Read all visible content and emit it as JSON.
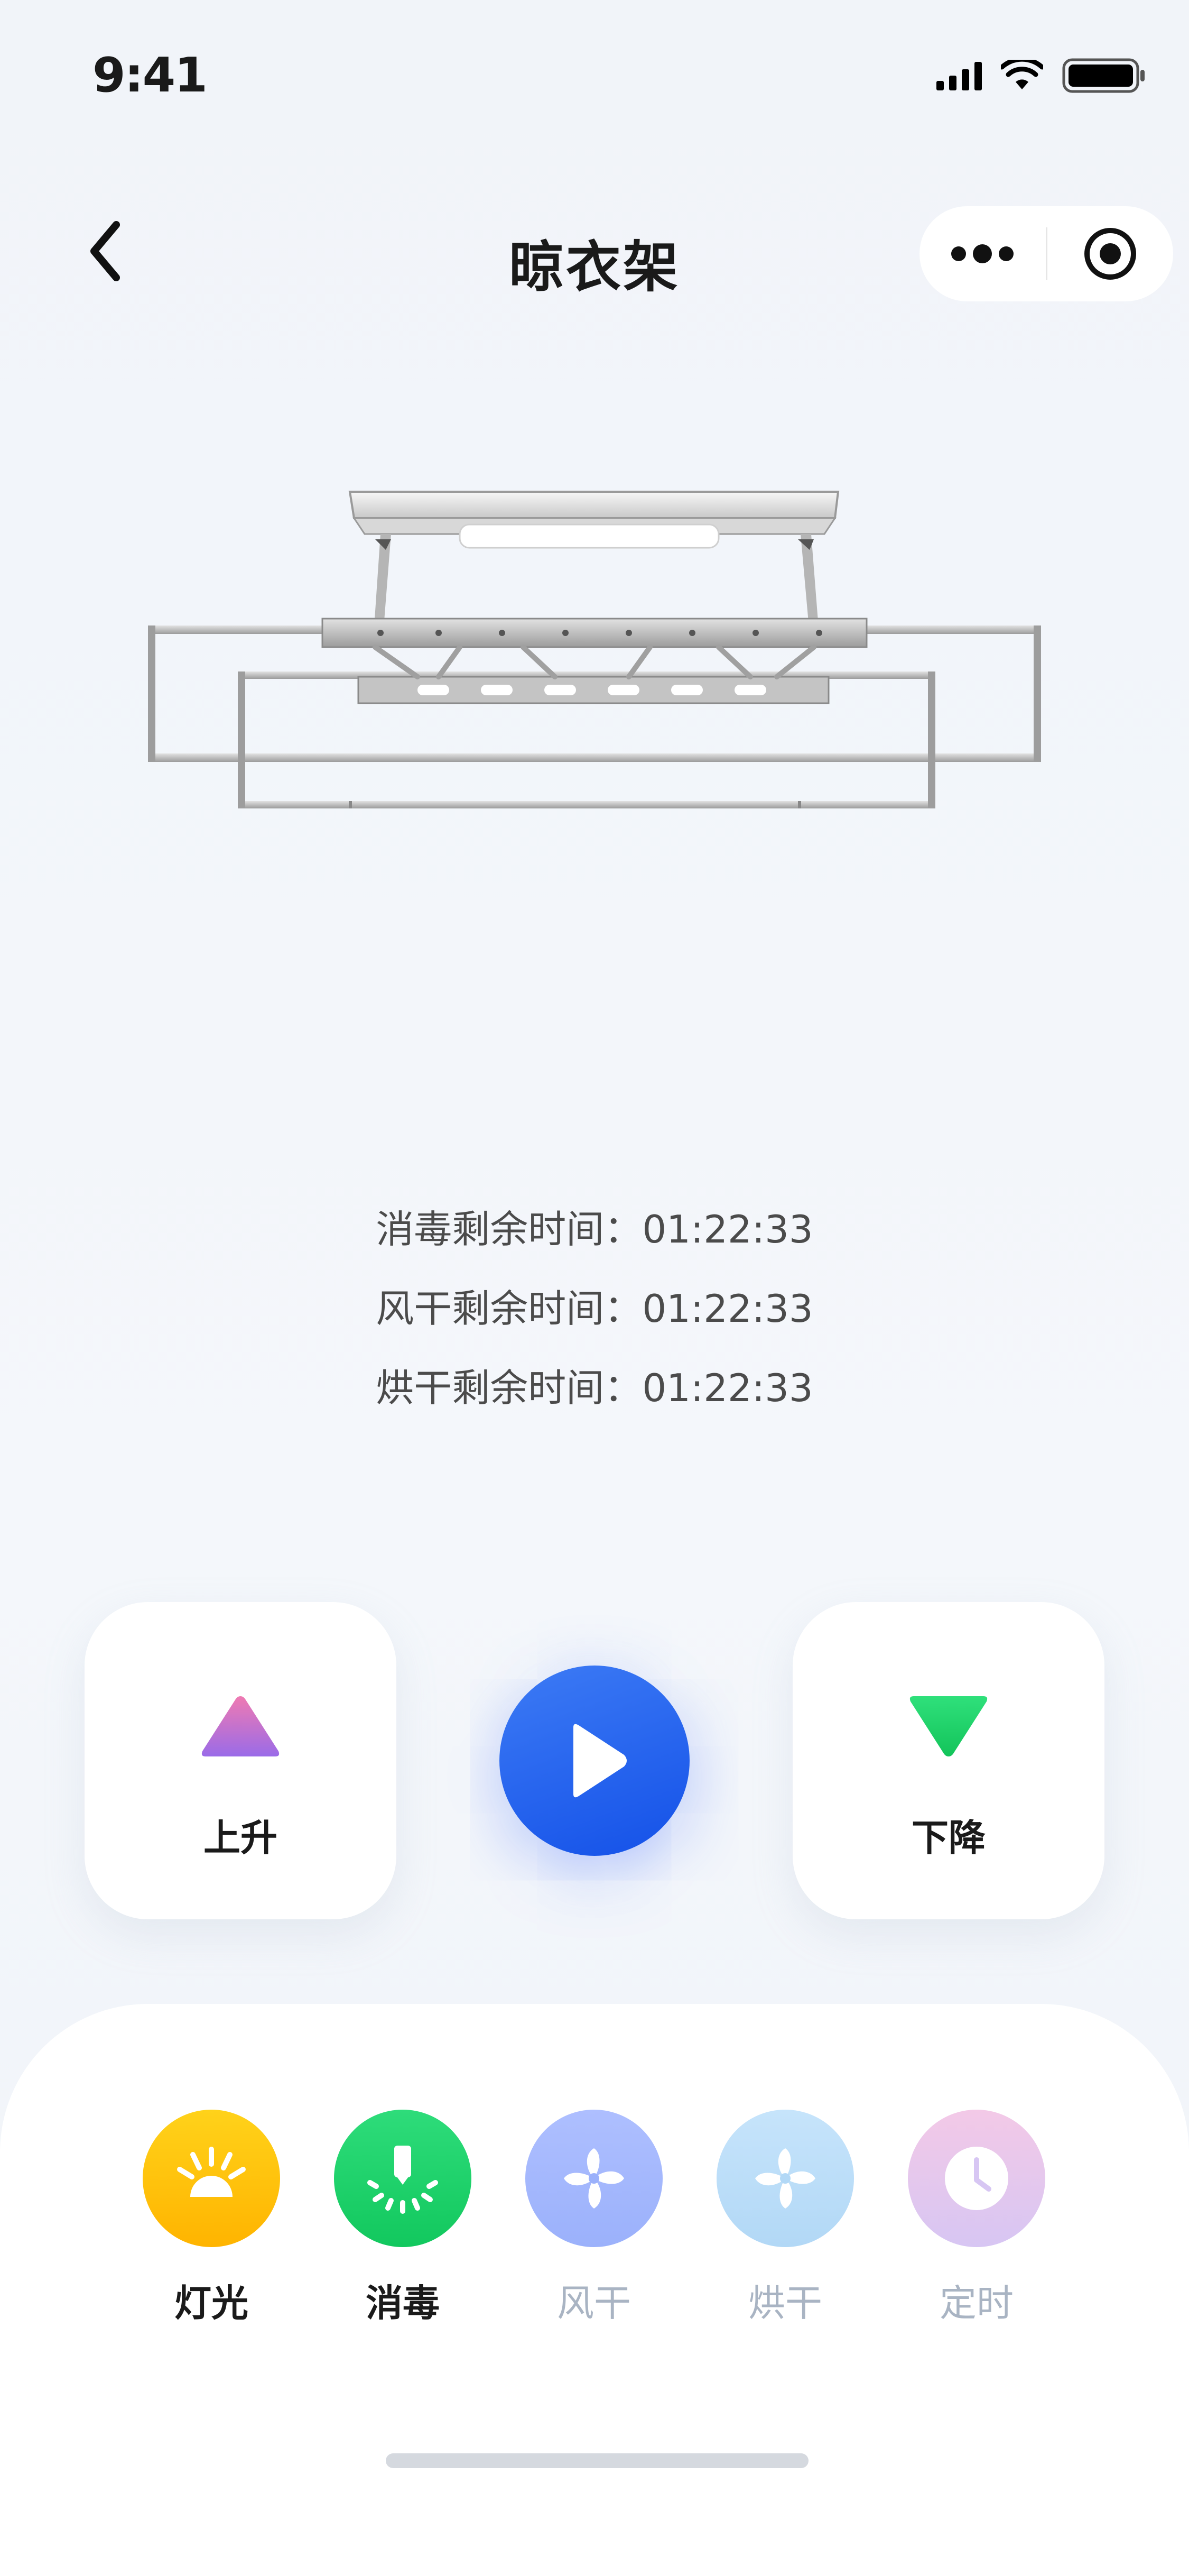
{
  "status_bar": {
    "time": "9:41"
  },
  "nav": {
    "title": "晾衣架"
  },
  "timers": [
    {
      "label": "消毒剩余时间：",
      "value": "01:22:33"
    },
    {
      "label": "风干剩余时间：",
      "value": "01:22:33"
    },
    {
      "label": "烘干剩余时间：",
      "value": "01:22:33"
    }
  ],
  "controls": {
    "up_label": "上升",
    "down_label": "下降"
  },
  "features": [
    {
      "label": "灯光",
      "icon": "light-icon",
      "enabled": true,
      "color_top": "#ffd21a",
      "color_bottom": "#ffb400"
    },
    {
      "label": "消毒",
      "icon": "disinfect-icon",
      "enabled": true,
      "color_top": "#2edc7a",
      "color_bottom": "#12c85e"
    },
    {
      "label": "风干",
      "icon": "fan-icon",
      "enabled": false,
      "color_top": "#aebfff",
      "color_bottom": "#9bb1fb"
    },
    {
      "label": "烘干",
      "icon": "fan-icon",
      "enabled": false,
      "color_top": "#c6e4fb",
      "color_bottom": "#b2d8f6"
    },
    {
      "label": "定时",
      "icon": "clock-icon",
      "enabled": false,
      "color_top": "#f3c9e7",
      "color_bottom": "#d7c6f3"
    }
  ],
  "colors": {
    "accent_blue": "#1f5ff0",
    "up_gradient": [
      "#ef7ab2",
      "#9a6be8"
    ],
    "down_gradient": [
      "#2fe07b",
      "#13c45a"
    ]
  }
}
